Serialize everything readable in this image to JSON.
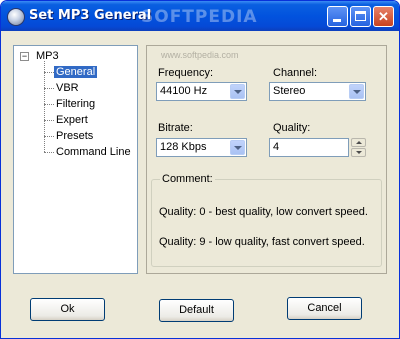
{
  "window": {
    "title": "Set MP3 General",
    "watermark": "SOFTPEDIA",
    "controls": {
      "minimize": "_",
      "maximize": "□",
      "close": "✕"
    }
  },
  "panel_watermark": "www.softpedia.com",
  "tree": {
    "root": "MP3",
    "expander": "−",
    "items": [
      "General",
      "VBR",
      "Filtering",
      "Expert",
      "Presets",
      "Command Line"
    ],
    "selected": "General"
  },
  "settings": {
    "frequency": {
      "label": "Frequency:",
      "value": "44100 Hz"
    },
    "channel": {
      "label": "Channel:",
      "value": "Stereo"
    },
    "bitrate": {
      "label": "Bitrate:",
      "value": "128 Kbps"
    },
    "quality": {
      "label": "Quality:",
      "value": "4"
    }
  },
  "comment": {
    "legend": "Comment:",
    "line1": "Quality: 0 - best quality, low convert speed.",
    "line2": "Quality: 9 - low quality, fast convert speed."
  },
  "buttons": {
    "ok": "Ok",
    "default": "Default",
    "cancel": "Cancel"
  },
  "colors": {
    "titlebar": "#0253de",
    "selection": "#316ac5",
    "face": "#ece9d8"
  }
}
